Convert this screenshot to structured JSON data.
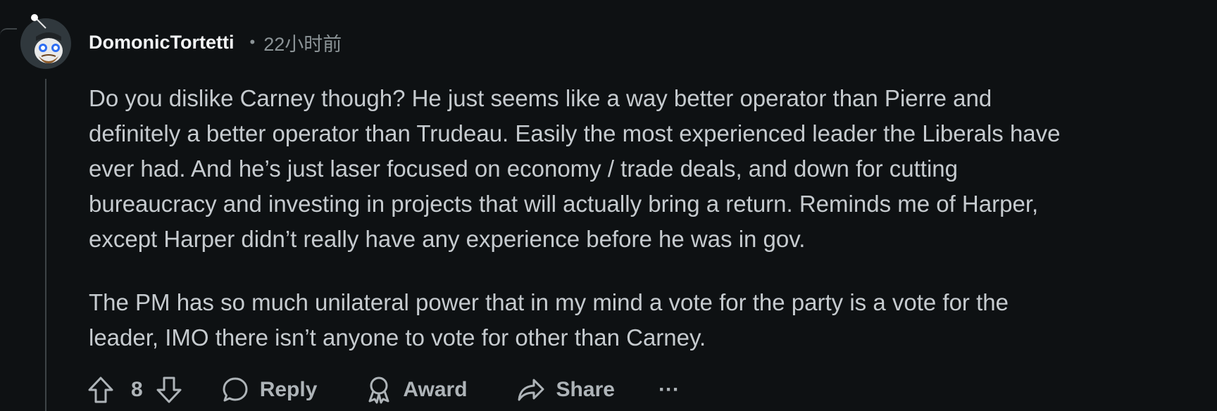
{
  "comment": {
    "username": "DomonicTortetti",
    "separator": "•",
    "timestamp": "22小时前",
    "paragraphs": [
      "Do you dislike Carney though? He just seems like a way better operator than Pierre and\ndefinitely a better operator than Trudeau. Easily the most experienced leader the Liberals have\never had. And he’s just laser focused on economy / trade deals, and down for cutting\nbureaucracy and investing in projects that will actually bring a return. Reminds me of Harper,\nexcept Harper didn’t really have any experience before he was in gov.",
      "The PM has so much unilateral power that in my mind a vote for the party is a vote for the\nleader, IMO there isn’t anyone to vote for other than Carney."
    ]
  },
  "actions": {
    "upvote_icon": "arrow-up-icon",
    "vote_count": "8",
    "downvote_icon": "arrow-down-icon",
    "reply_icon": "speech-bubble-icon",
    "reply_label": "Reply",
    "award_icon": "award-ribbon-icon",
    "award_label": "Award",
    "share_icon": "share-arrow-icon",
    "share_label": "Share",
    "more_icon": "more-dots-icon",
    "more_label": "···"
  },
  "colors": {
    "background": "#0e1113",
    "username": "#f2f4f5",
    "body_text": "#c6cbcf",
    "meta_text": "#8b9396",
    "thread_line": "#3e4447"
  }
}
